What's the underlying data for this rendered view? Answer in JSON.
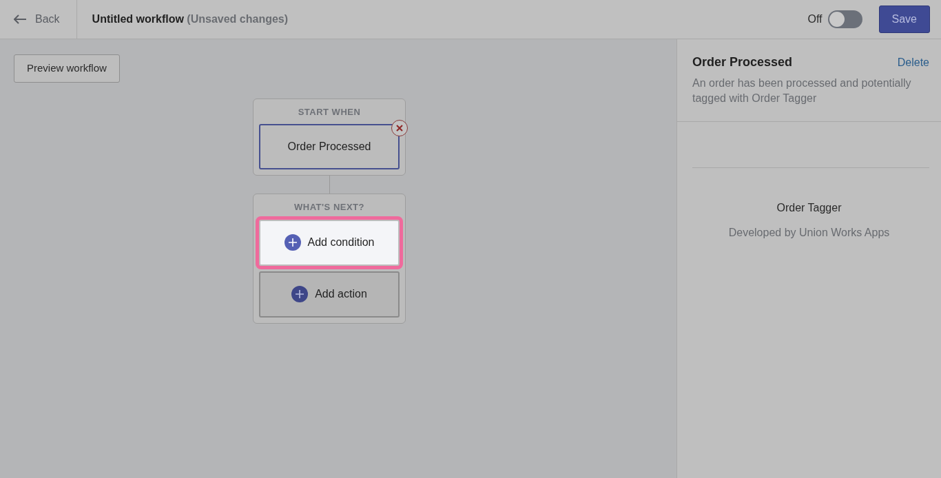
{
  "header": {
    "back_label": "Back",
    "title": "Untitled workflow",
    "title_suffix": "(Unsaved changes)",
    "toggle": {
      "label": "Off",
      "on": false
    },
    "save_label": "Save"
  },
  "preview_button": "Preview workflow",
  "trigger_block": {
    "heading": "START WHEN",
    "trigger": {
      "label": "Order Processed",
      "selected": true
    }
  },
  "next_block": {
    "heading": "WHAT'S NEXT?",
    "options": [
      {
        "label": "Add condition",
        "highlighted": true
      },
      {
        "label": "Add action",
        "highlighted": false
      }
    ]
  },
  "panel": {
    "title": "Order Processed",
    "delete_label": "Delete",
    "description": "An order has been processed and potentially tagged with Order Tagger",
    "app_name": "Order Tagger",
    "developer": "Developed by Union Works Apps"
  }
}
